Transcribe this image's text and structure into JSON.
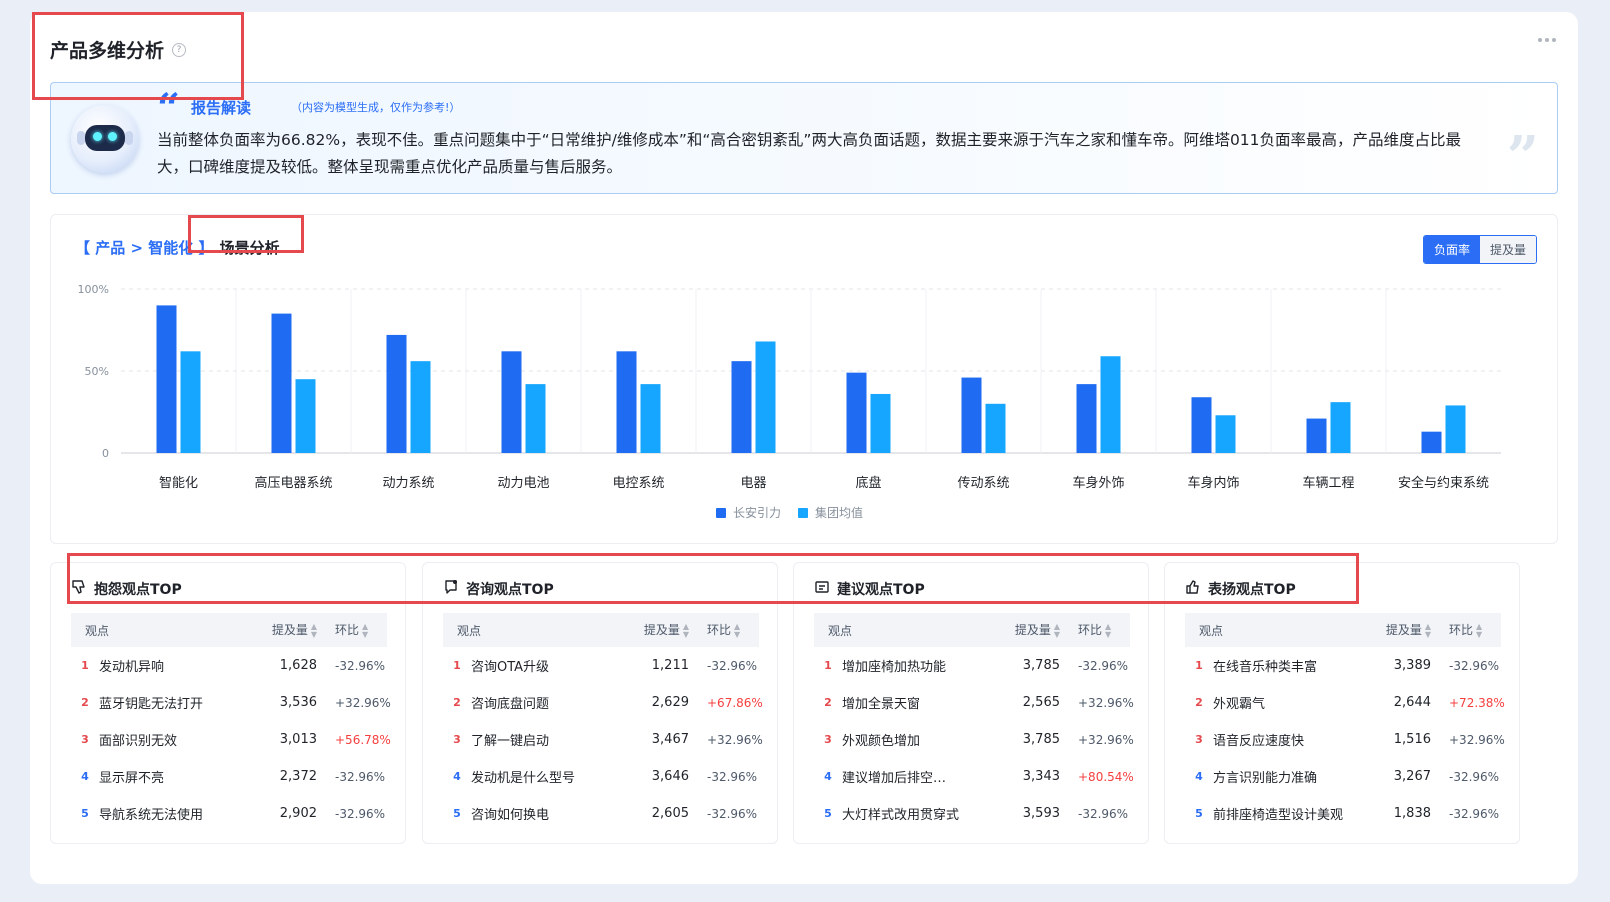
{
  "page": {
    "title": "产品多维分析",
    "help_symbol": "?"
  },
  "report": {
    "label": "报告解读",
    "note": "（内容为模型生成，仅作为参考!）",
    "text": "当前整体负面率为66.82%，表现不佳。重点问题集中于“日常维护/维修成本”和“高合密钥紊乱”两大高负面话题，数据主要来源于汽车之家和懂车帝。阿维塔011负面率最高，产品维度占比最大，口碑维度提及较低。整体呈现需重点优化产品质量与售后服务。"
  },
  "chart_section": {
    "breadcrumb_link": "【 产品 > 智能化 】",
    "breadcrumb_current": "场景分析",
    "toggle": [
      "负面率",
      "提及量"
    ],
    "toggle_active": 0
  },
  "colors": {
    "series_primary": "#1f6bf2",
    "series_secondary": "#16a6ff",
    "accent": "#2b6ef5",
    "highlight_box": "#e5484d",
    "negative_change": "#f53f3f"
  },
  "chart_data": {
    "type": "bar",
    "categories": [
      "智能化",
      "高压电器系统",
      "动力系统",
      "动力电池",
      "电控系统",
      "电器",
      "底盘",
      "传动系统",
      "车身外饰",
      "车身内饰",
      "车辆工程",
      "安全与约束系统"
    ],
    "series": [
      {
        "name": "长安引力",
        "values": [
          90,
          85,
          72,
          62,
          62,
          56,
          49,
          46,
          42,
          34,
          21,
          13
        ]
      },
      {
        "name": "集团均值",
        "values": [
          62,
          45,
          56,
          42,
          42,
          68,
          36,
          30,
          59,
          23,
          31,
          29
        ]
      }
    ],
    "yticks": [
      "100%",
      "50%",
      "0"
    ],
    "ytick_values": [
      100,
      50,
      0
    ],
    "ylim": [
      0,
      100
    ],
    "grid": true,
    "legend_position": "bottom-center"
  },
  "panels": [
    {
      "title": "抱怨观点TOP",
      "icon": "thumbs-down-icon",
      "headers": {
        "view": "观点",
        "count": "提及量",
        "change": "环比"
      },
      "rows": [
        {
          "rank": "1",
          "view": "发动机异响",
          "count": "1,628",
          "change": "-32.96%",
          "up": false
        },
        {
          "rank": "2",
          "view": "蓝牙钥匙无法打开",
          "count": "3,536",
          "change": "+32.96%",
          "up": false
        },
        {
          "rank": "3",
          "view": "面部识别无效",
          "count": "3,013",
          "change": "+56.78%",
          "up": true
        },
        {
          "rank": "4",
          "view": "显示屏不亮",
          "count": "2,372",
          "change": "-32.96%",
          "up": false
        },
        {
          "rank": "5",
          "view": "导航系统无法使用",
          "count": "2,902",
          "change": "-32.96%",
          "up": false
        }
      ]
    },
    {
      "title": "咨询观点TOP",
      "icon": "chat-question-icon",
      "headers": {
        "view": "观点",
        "count": "提及量",
        "change": "环比"
      },
      "rows": [
        {
          "rank": "1",
          "view": "咨询OTA升级",
          "count": "1,211",
          "change": "-32.96%",
          "up": false
        },
        {
          "rank": "2",
          "view": "咨询底盘问题",
          "count": "2,629",
          "change": "+67.86%",
          "up": true
        },
        {
          "rank": "3",
          "view": "了解一键启动",
          "count": "3,467",
          "change": "+32.96%",
          "up": false
        },
        {
          "rank": "4",
          "view": "发动机是什么型号",
          "count": "3,646",
          "change": "-32.96%",
          "up": false
        },
        {
          "rank": "5",
          "view": "咨询如何换电",
          "count": "2,605",
          "change": "-32.96%",
          "up": false
        }
      ]
    },
    {
      "title": "建议观点TOP",
      "icon": "suggestion-icon",
      "headers": {
        "view": "观点",
        "count": "提及量",
        "change": "环比"
      },
      "rows": [
        {
          "rank": "1",
          "view": "增加座椅加热功能",
          "count": "3,785",
          "change": "-32.96%",
          "up": false
        },
        {
          "rank": "2",
          "view": "增加全景天窗",
          "count": "2,565",
          "change": "+32.96%",
          "up": false
        },
        {
          "rank": "3",
          "view": "外观颜色增加",
          "count": "3,785",
          "change": "+32.96%",
          "up": false
        },
        {
          "rank": "4",
          "view": "建议增加后排空…",
          "count": "3,343",
          "change": "+80.54%",
          "up": true
        },
        {
          "rank": "5",
          "view": "大灯样式改用贯穿式",
          "count": "3,593",
          "change": "-32.96%",
          "up": false
        }
      ]
    },
    {
      "title": "表扬观点TOP",
      "icon": "thumbs-up-icon",
      "headers": {
        "view": "观点",
        "count": "提及量",
        "change": "环比"
      },
      "rows": [
        {
          "rank": "1",
          "view": "在线音乐种类丰富",
          "count": "3,389",
          "change": "-32.96%",
          "up": false
        },
        {
          "rank": "2",
          "view": "外观霸气",
          "count": "2,644",
          "change": "+72.38%",
          "up": true
        },
        {
          "rank": "3",
          "view": "语音反应速度快",
          "count": "1,516",
          "change": "+32.96%",
          "up": false
        },
        {
          "rank": "4",
          "view": "方言识别能力准确",
          "count": "3,267",
          "change": "-32.96%",
          "up": false
        },
        {
          "rank": "5",
          "view": "前排座椅造型设计美观",
          "count": "1,838",
          "change": "-32.96%",
          "up": false
        }
      ]
    }
  ]
}
